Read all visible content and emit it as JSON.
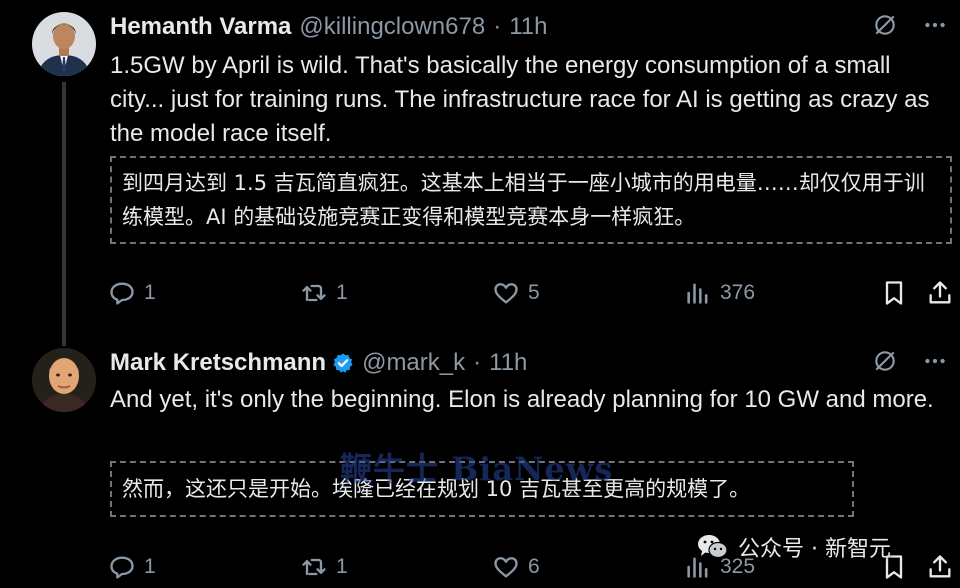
{
  "tweets": [
    {
      "name": "Hemanth Varma",
      "handle": "@killingclown678",
      "separator": "·",
      "time": "11h",
      "text": "1.5GW by April is wild. That's basically the energy consumption of a small city... just for training runs. The infrastructure race for AI is getting as crazy as the model race itself.",
      "translation": "到四月达到 1.5 吉瓦简直疯狂。这基本上相当于一座小城市的用电量……却仅仅用于训练模型。AI 的基础设施竞赛正变得和模型竞赛本身一样疯狂。",
      "replies": "1",
      "reposts": "1",
      "likes": "5",
      "views": "376",
      "verified": false
    },
    {
      "name": "Mark Kretschmann",
      "handle": "@mark_k",
      "separator": "·",
      "time": "11h",
      "text": "And yet, it's only the beginning. Elon is already planning for 10 GW and more.",
      "translation": "然而，这还只是开始。埃隆已经在规划 10 吉瓦甚至更高的规模了。",
      "replies": "1",
      "reposts": "1",
      "likes": "6",
      "views": "325",
      "verified": true
    }
  ],
  "watermark": "鞭牛士 BiaNews",
  "wechat_label": "公众号 · 新智元",
  "colors": {
    "background": "#000000",
    "text": "#e7e9ea",
    "muted": "#8b98a5",
    "verified": "#1d9bf0",
    "divider": "#333639"
  },
  "icons": [
    "grok-icon",
    "more-icon",
    "reply-icon",
    "repost-icon",
    "like-icon",
    "views-icon",
    "bookmark-icon",
    "share-icon",
    "verified-badge-icon",
    "wechat-icon"
  ]
}
